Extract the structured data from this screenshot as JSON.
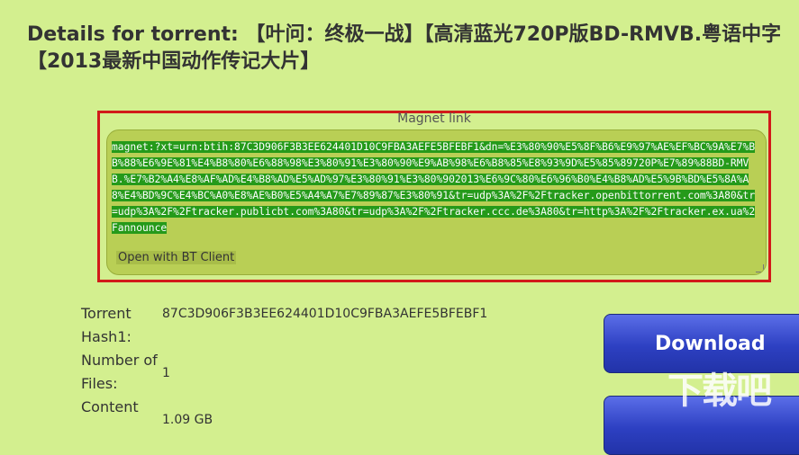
{
  "page": {
    "title_line1": "Details for torrent: 【叶问：终极一战】【高清蓝光720P版BD-RMVB.粤语中字",
    "title_line2": "【2013最新中国动作传记大片】"
  },
  "magnet": {
    "label": "Magnet link",
    "text": "magnet:?xt=urn:btih:87C3D906F3B3EE624401D10C9FBA3AEFE5BFEBF1&dn=%E3%80%90%E5%8F%B6%E9%97%AE%EF%BC%9A%E7%BB%88%E6%9E%81%E4%B8%80%E6%88%98%E3%80%91%E3%80%90%E9%AB%98%E6%B8%85%E8%93%9D%E5%85%89720P%E7%89%88BD-RMVB.%E7%B2%A4%E8%AF%AD%E4%B8%AD%E5%AD%97%E3%80%91%E3%80%902013%E6%9C%80%E6%96%B0%E4%B8%AD%E5%9B%BD%E5%8A%A8%E4%BD%9C%E4%BC%A0%E8%AE%B0%E5%A4%A7%E7%89%87%E3%80%91&tr=udp%3A%2F%2Ftracker.openbittorrent.com%3A80&tr=udp%3A%2F%2Ftracker.publicbt.com%3A80&tr=udp%3A%2F%2Ftracker.ccc.de%3A80&tr=http%3A%2F%2Ftracker.ex.ua%2Fannounce",
    "open_button": "Open with BT Client"
  },
  "details": {
    "rows": [
      {
        "label": "Torrent Hash1:",
        "value": "87C3D906F3B3EE624401D10C9FBA3AEFE5BFEBF1"
      },
      {
        "label": "Number of Files:",
        "value": "1"
      },
      {
        "label": "Content",
        "value": "1.09 GB"
      }
    ]
  },
  "buttons": {
    "download": "Download",
    "second": ""
  },
  "watermark": {
    "text": "下载吧"
  }
}
